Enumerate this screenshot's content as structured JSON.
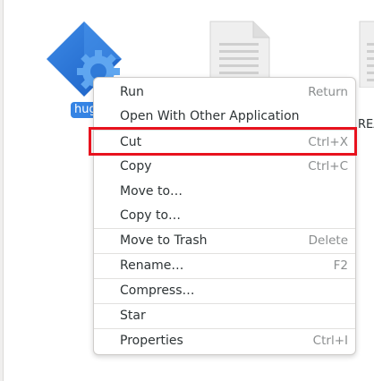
{
  "files": [
    {
      "name": "hug",
      "icon": "hugo-executable-icon",
      "selected": true
    },
    {
      "name": "",
      "icon": "text-document-icon",
      "selected": false
    },
    {
      "name": "REA",
      "icon": "text-document-icon",
      "selected": false
    }
  ],
  "context_menu": {
    "items": [
      {
        "label": "Run",
        "accel": "Return"
      },
      {
        "label": "Open With Other Application",
        "accel": ""
      },
      {
        "label": "Cut",
        "accel": "Ctrl+X"
      },
      {
        "label": "Copy",
        "accel": "Ctrl+C"
      },
      {
        "label": "Move to…",
        "accel": ""
      },
      {
        "label": "Copy to…",
        "accel": ""
      },
      {
        "label": "Move to Trash",
        "accel": "Delete"
      },
      {
        "label": "Rename…",
        "accel": "F2"
      },
      {
        "label": "Compress…",
        "accel": ""
      },
      {
        "label": "Star",
        "accel": ""
      },
      {
        "label": "Properties",
        "accel": "Ctrl+I"
      }
    ]
  },
  "colors": {
    "selection": "#3584e4",
    "highlight_box": "#e8121e",
    "accelerator_text": "#8b8e8f"
  }
}
